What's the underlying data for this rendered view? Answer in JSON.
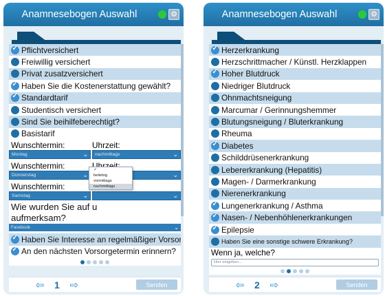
{
  "app_title": "Anamnesebogen Auswahl",
  "gear_glyph": "⚙",
  "screen1": {
    "items": [
      {
        "label": "Pflichtversichert",
        "checked": true,
        "shaded": true
      },
      {
        "label": "Freiwillig versichert",
        "checked": false,
        "shaded": false
      },
      {
        "label": "Privat zusatzversichert",
        "checked": false,
        "shaded": true
      },
      {
        "label": "Haben Sie die Kostenerstattung gewählt?",
        "checked": true,
        "shaded": false
      },
      {
        "label": "Standardtarif",
        "checked": true,
        "shaded": true
      },
      {
        "label": "Studentisch versichert",
        "checked": false,
        "shaded": false
      },
      {
        "label": "Sind Sie beihilfeberechtigt?",
        "checked": false,
        "shaded": true
      },
      {
        "label": "Basistarif",
        "checked": false,
        "shaded": false
      }
    ],
    "appointments": [
      {
        "wunsch_label": "Wunschtermin:",
        "uhr_label": "Uhrzeit:",
        "day": "Montag",
        "time": "nachmittags"
      },
      {
        "wunsch_label": "Wunschtermin:",
        "uhr_label": "Uhrzeit:",
        "day": "Donnerstag",
        "time": "nachmittags"
      },
      {
        "wunsch_label": "Wunschtermin:",
        "uhr_label": "Uhrzeit:",
        "day": "Samstag",
        "time": ""
      }
    ],
    "dropdown_check": "✓",
    "dropdown_options": [
      "beliebig",
      "vormittags",
      "nachmittags"
    ],
    "question": "Wie wurden Sie auf u aufmerksam?",
    "question_line1": "Wie wurden Sie auf u",
    "question_line2": "aufmerksam?",
    "source_value": "Facebook",
    "bottom_items": [
      {
        "label": "Haben Sie Interesse an regelmäßiger Vorsorge?",
        "checked": true,
        "shaded": true
      },
      {
        "label": "An den nächsten Vorsorgetermin erinnern?",
        "checked": true,
        "shaded": false
      }
    ],
    "page_number": "1",
    "send_label": "Senden"
  },
  "screen2": {
    "items": [
      {
        "label": "Herzerkrankung",
        "checked": true,
        "shaded": true
      },
      {
        "label": "Herzschrittmacher / Künstl. Herzklappen",
        "checked": false,
        "shaded": false
      },
      {
        "label": "Hoher Blutdruck",
        "checked": true,
        "shaded": true
      },
      {
        "label": "Niedriger Blutdruck",
        "checked": false,
        "shaded": false
      },
      {
        "label": "Ohnmachtsneigung",
        "checked": false,
        "shaded": true
      },
      {
        "label": "Marcumar / Gerinnungshemmer",
        "checked": false,
        "shaded": false
      },
      {
        "label": "Blutungsneigung / Bluterkrankung",
        "checked": false,
        "shaded": true
      },
      {
        "label": "Rheuma",
        "checked": false,
        "shaded": false
      },
      {
        "label": "Diabetes",
        "checked": true,
        "shaded": true
      },
      {
        "label": "Schilddrüsenerkrankung",
        "checked": false,
        "shaded": false
      },
      {
        "label": "Lebererkrankung (Hepatitis)",
        "checked": false,
        "shaded": true
      },
      {
        "label": "Magen- / Darmerkrankung",
        "checked": false,
        "shaded": false
      },
      {
        "label": "Nierenerkrankung",
        "checked": false,
        "shaded": true
      },
      {
        "label": "Lungenerkrankung / Asthma",
        "checked": true,
        "shaded": false
      },
      {
        "label": "Nasen- / Nebenhöhlenerkrankungen",
        "checked": true,
        "shaded": true
      },
      {
        "label": "Epilepsie",
        "checked": true,
        "shaded": false
      },
      {
        "label": "Haben Sie eine sonstige schwere Erkrankung?",
        "checked": false,
        "shaded": true,
        "small": true
      }
    ],
    "followup_label": "Wenn ja, welche?",
    "followup_placeholder": "Hier eingeben...",
    "page_number": "2",
    "send_label": "Senden"
  },
  "nav": {
    "prev_glyph": "⇦",
    "next_glyph": "⇨"
  },
  "colors": {
    "header": "#1f6fa3",
    "accent": "#2f7db8",
    "status_dot": "#2fc63f",
    "shaded_row": "#c6dcec"
  }
}
